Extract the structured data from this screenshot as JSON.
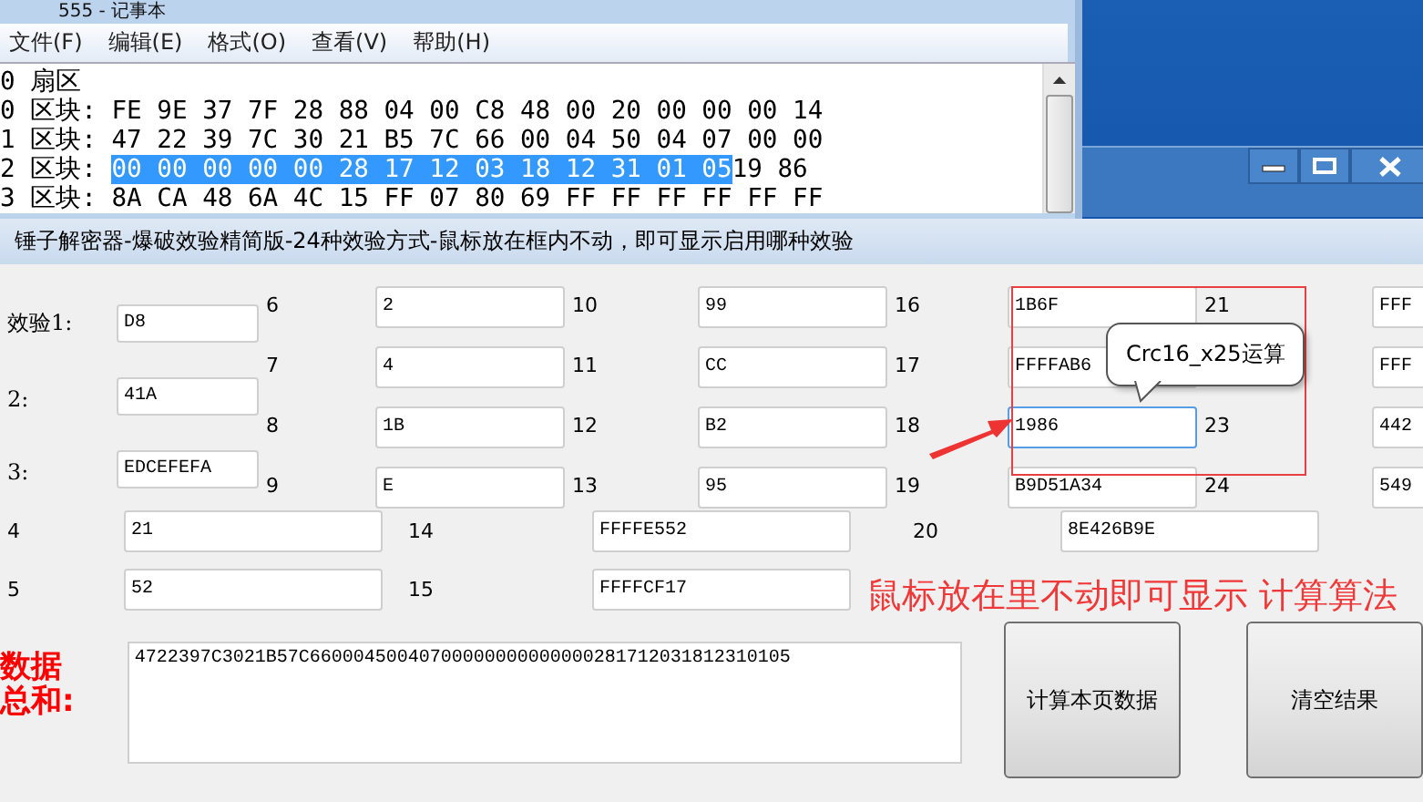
{
  "notepad": {
    "title": "555 - 记事本",
    "menu": [
      "文件(F)",
      "编辑(E)",
      "格式(O)",
      "查看(V)",
      "帮助(H)"
    ],
    "lines": [
      {
        "segments": [
          {
            "text": "0 扇区",
            "selected": false
          }
        ]
      },
      {
        "segments": [
          {
            "text": "0 区块: FE 9E 37 7F 28 88 04 00 C8 48 00 20 00 00 00 14",
            "selected": false
          }
        ]
      },
      {
        "segments": [
          {
            "text": "1 区块: 47 22 39 7C 30 21 B5 7C 66 00 04 50 04 07 00 00",
            "selected": false
          }
        ]
      },
      {
        "segments": [
          {
            "text": "2 区块: ",
            "selected": false
          },
          {
            "text": "00 00 00 00 00 28 17 12 03 18 12 31 01 05",
            "selected": true
          },
          {
            "text": "19 86",
            "selected": false
          }
        ]
      },
      {
        "segments": [
          {
            "text": "3 区块: 8A CA 48 6A 4C 15 FF 07 80 69 FF FF FF FF FF FF",
            "selected": false
          }
        ]
      }
    ]
  },
  "dialog": {
    "title": "锤子解密器-爆破效验精简版-24种效验方式-鼠标放在框内不动，即可显示启用哪种效验",
    "checks": [
      {
        "label": "效验1:",
        "value": "D8"
      },
      {
        "label": "2:",
        "value": "41A"
      },
      {
        "label": "3:",
        "value": "EDCEFEFA"
      }
    ],
    "grid": [
      [
        {
          "number": "6",
          "value": "2",
          "focused": false
        },
        {
          "number": "10",
          "value": "99",
          "focused": false
        },
        {
          "number": "16",
          "value": "1B6F",
          "focused": false
        },
        {
          "number": "21",
          "value": "FFF",
          "focused": false
        }
      ],
      [
        {
          "number": "7",
          "value": "4",
          "focused": false
        },
        {
          "number": "11",
          "value": "CC",
          "focused": false
        },
        {
          "number": "17",
          "value": "FFFFAB6",
          "focused": false
        },
        {
          "value": "FFF",
          "focused": false
        }
      ],
      [
        {
          "number": "8",
          "value": "1B",
          "focused": false
        },
        {
          "number": "12",
          "value": "B2",
          "focused": false
        },
        {
          "number": "18",
          "value": "1986",
          "focused": true
        },
        {
          "number": "23",
          "value": "442",
          "focused": false
        }
      ],
      [
        {
          "number": "9",
          "value": "E",
          "focused": false
        },
        {
          "number": "13",
          "value": "95",
          "focused": false
        },
        {
          "number": "19",
          "value": "B9D51A34",
          "focused": false
        },
        {
          "number": "24",
          "value": "549",
          "focused": false
        }
      ]
    ],
    "lower_rows": [
      [
        {
          "number": "4",
          "value": "21"
        },
        {
          "number": "14",
          "value": "FFFFE552"
        },
        {
          "number": "20",
          "value": "8E426B9E"
        }
      ],
      [
        {
          "number": "5",
          "value": "52"
        },
        {
          "number": "15",
          "value": "FFFFCF17"
        }
      ]
    ],
    "sum_label": "数据总和:",
    "sum_value": "4722397C3021B57C66000450040700000000000000281712031812310105",
    "buttons": [
      "计算本页数据",
      "清空结果"
    ]
  },
  "annotations": {
    "tooltip": "Crc16_x25运算",
    "note": "鼠标放在里不动即可显示 计算算法"
  }
}
